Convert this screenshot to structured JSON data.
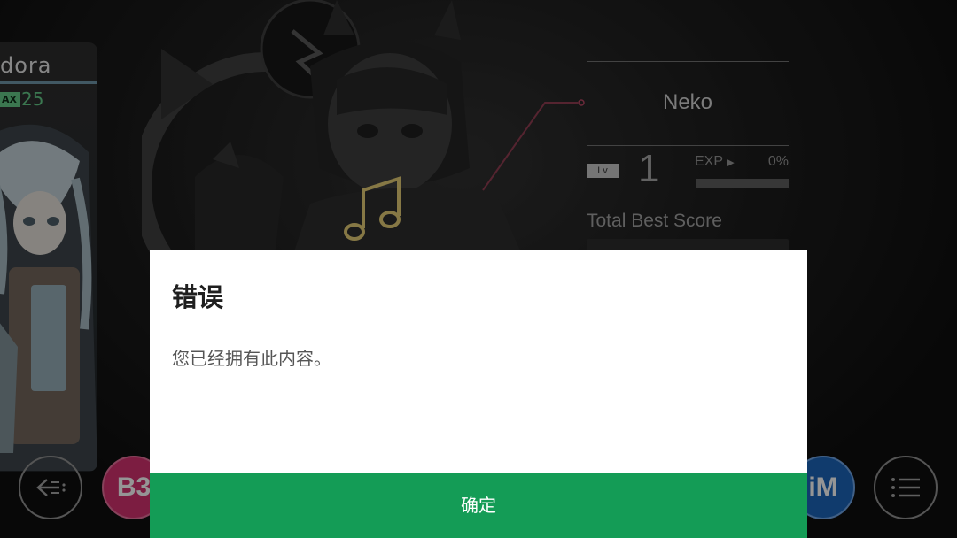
{
  "song_card": {
    "title": "dora",
    "difficulty_badge": "AX",
    "difficulty_level": "25"
  },
  "profile": {
    "player_name": "Neko",
    "lv_label": "Lv",
    "level": "1",
    "exp_label": "EXP",
    "exp_percent": "0%",
    "exp_progress": 0,
    "best_score_label": "Total Best Score"
  },
  "bottom_buttons": {
    "back_icon": "back-arrow-icon",
    "pink_button_glyph": "B3",
    "blue_button_glyph": "iM",
    "menu_icon": "menu-list-icon"
  },
  "dialog": {
    "title": "错误",
    "message": "您已经拥有此内容。",
    "ok_label": "确定"
  },
  "colors": {
    "dialog_button": "#149c56",
    "difficulty_green": "#5fc082",
    "note_gold": "#d8c270"
  }
}
